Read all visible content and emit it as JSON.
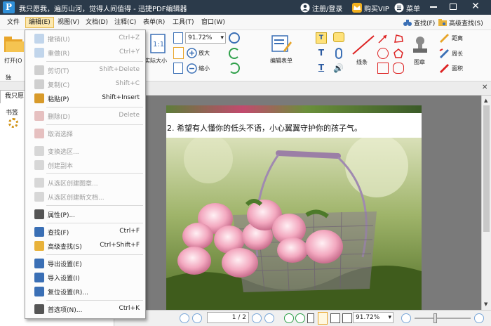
{
  "window": {
    "title": "我只愿我，遍历山河，觉得人间值得 - 迅捷PDF编辑器",
    "login": "注册/登录",
    "vip": "购买VIP",
    "menu": "菜单",
    "logo": "P"
  },
  "menubar": [
    "文件",
    "编辑(E)",
    "视图(V)",
    "文档(D)",
    "注释(C)",
    "表单(R)",
    "工具(T)",
    "窗口(W)"
  ],
  "ribbon": {
    "open": "打开(O",
    "actual_size": "实际大小",
    "zoom_value": "91.72%",
    "zoom_in": "放大",
    "zoom_out": "缩小",
    "edit_form": "编辑表单",
    "line": "线条",
    "stamp": "图章",
    "find": "查找(F)",
    "adv_find": "高级查找(S)",
    "distance": "距离",
    "perimeter": "周长",
    "area": "面积",
    "hand_label": "独"
  },
  "sidebar": {
    "doc_tab": "我只愿",
    "bookmarks": "书签"
  },
  "document": {
    "caption": "2. 希望有人懂你的低头不语，小心翼翼守护你的孩子气。"
  },
  "status": {
    "page_current": "1",
    "page_total": "2",
    "zoom": "91.72%"
  },
  "dropdown": [
    {
      "label": "撤销(U)",
      "shortcut": "Ctrl+Z",
      "disabled": true,
      "icon": "undo-icon"
    },
    {
      "label": "重做(R)",
      "shortcut": "Ctrl+Y",
      "disabled": true,
      "icon": "redo-icon"
    },
    {
      "label": "剪切(T)",
      "shortcut": "Shift+Delete",
      "disabled": true,
      "icon": "cut-icon"
    },
    {
      "label": "复制(C)",
      "shortcut": "Shift+C",
      "disabled": true,
      "icon": "copy-icon"
    },
    {
      "label": "粘贴(P)",
      "shortcut": "Shift+Insert",
      "disabled": false,
      "icon": "paste-icon"
    },
    {
      "label": "删除(D)",
      "shortcut": "Delete",
      "disabled": true,
      "icon": "delete-icon"
    },
    {
      "label": "取消选择",
      "shortcut": "",
      "disabled": true,
      "icon": "deselect-icon"
    },
    {
      "label": "变换选区...",
      "shortcut": "",
      "disabled": true,
      "icon": "transform-selection-icon"
    },
    {
      "label": "创建副本",
      "shortcut": "",
      "disabled": true,
      "icon": "duplicate-icon"
    },
    {
      "label": "从选区创建图章...",
      "shortcut": "",
      "disabled": true,
      "icon": "stamp-from-selection-icon"
    },
    {
      "label": "从选区创建新文档...",
      "shortcut": "",
      "disabled": true,
      "icon": "doc-from-selection-icon"
    },
    {
      "label": "属性(P)...",
      "shortcut": "",
      "disabled": false,
      "icon": "properties-icon"
    },
    {
      "label": "查找(F)",
      "shortcut": "Ctrl+F",
      "disabled": false,
      "icon": "find-icon"
    },
    {
      "label": "高级查找(S)",
      "shortcut": "Ctrl+Shift+F",
      "disabled": false,
      "icon": "advanced-find-icon"
    },
    {
      "label": "导出设置(E)",
      "shortcut": "",
      "disabled": false,
      "icon": "export-settings-icon"
    },
    {
      "label": "导入设置(I)",
      "shortcut": "",
      "disabled": false,
      "icon": "import-settings-icon"
    },
    {
      "label": "复位设置(R)...",
      "shortcut": "",
      "disabled": false,
      "icon": "reset-settings-icon"
    },
    {
      "label": "首选项(N)...",
      "shortcut": "Ctrl+K",
      "disabled": false,
      "icon": "preferences-icon"
    }
  ],
  "colors": {
    "titlebar": "#2b3a4a",
    "accent": "#2f8fd8",
    "menu_highlight": "#fce8b0"
  }
}
